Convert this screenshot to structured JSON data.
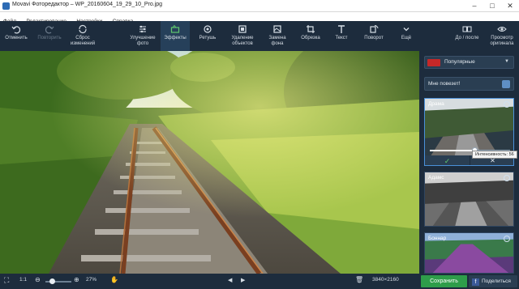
{
  "window": {
    "title": "Movavi Фоторедактор – WP_20160604_19_29_10_Pro.jpg",
    "minimize": "–",
    "maximize": "□",
    "close": "✕"
  },
  "menu": [
    "Файл",
    "Редактирование",
    "Настройки",
    "Справка"
  ],
  "toolbar": {
    "undo": "Отменить",
    "redo": "Повторить",
    "reset": "Сброс изменений",
    "enhance": "Улучшение фото",
    "effects": "Эффекты",
    "retouch": "Ретушь",
    "remove_objects": "Удаление объектов",
    "replace_bg": "Замена фона",
    "crop": "Обрезка",
    "text": "Текст",
    "rotate": "Поворот",
    "more": "Ещё",
    "before_after": "До / после",
    "view_original": "Просмотр оригинала"
  },
  "sidebar": {
    "preset": "Популярные",
    "lucky": "Мне повезет!",
    "effects": [
      {
        "name": "Драма",
        "selected": true
      },
      {
        "name": "Адамс",
        "selected": false
      },
      {
        "name": "Боннар",
        "selected": false
      }
    ],
    "intensity_label": "Интенсивность: 56",
    "intensity_value": 56,
    "intensity_max": 100
  },
  "statusbar": {
    "fit": "1:1",
    "zoom": "27%",
    "zoom_fraction": 0.27,
    "resolution": "3840×2160",
    "save": "Сохранить",
    "share": "Поделиться",
    "share_icon": "f"
  },
  "colors": {
    "accent_blue": "#4a90d9",
    "save_green": "#2e9d4a",
    "toolbar_bg": "#1d2c3d",
    "preset_red": "#c62828"
  },
  "icons": {
    "undo": "undo-icon",
    "redo": "redo-icon",
    "reset": "reset-icon",
    "enhance": "enhance-icon",
    "effects": "effects-icon",
    "retouch": "retouch-icon",
    "remove": "eraser-icon",
    "replace_bg": "background-icon",
    "crop": "crop-icon",
    "text": "text-icon",
    "rotate": "rotate-icon",
    "more": "chevron-down-icon",
    "before_after": "compare-icon",
    "original": "eye-icon"
  }
}
